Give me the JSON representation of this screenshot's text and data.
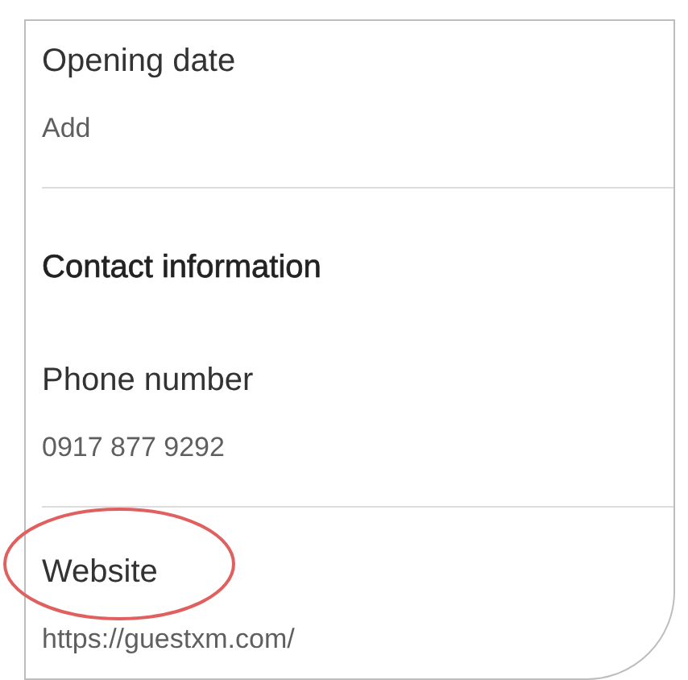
{
  "sections": [
    {
      "kind": "field",
      "label": "Opening date",
      "value": "Add",
      "divider_after": true,
      "circled": false
    },
    {
      "kind": "heading",
      "label": "Contact information"
    },
    {
      "kind": "field",
      "label": "Phone number",
      "value": "0917 877 9292",
      "divider_after": true,
      "circled": false
    },
    {
      "kind": "field",
      "label": "Website",
      "value": "https://guestxm.com/",
      "divider_after": false,
      "circled": true
    }
  ]
}
